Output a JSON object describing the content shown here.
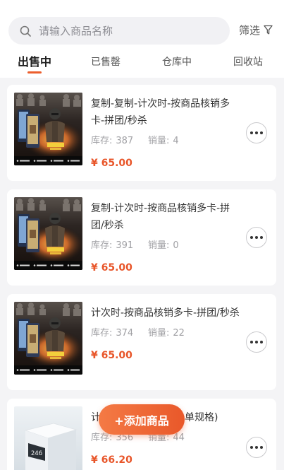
{
  "search": {
    "placeholder": "请输入商品名称"
  },
  "filter": {
    "label": "筛选"
  },
  "tabs": [
    {
      "label": "出售中",
      "active": true
    },
    {
      "label": "已售罄",
      "active": false
    },
    {
      "label": "仓库中",
      "active": false
    },
    {
      "label": "回收站",
      "active": false
    }
  ],
  "products": [
    {
      "title_lines": [
        "复制-复制-计次时-按商品核销多",
        "卡-拼团/秒杀"
      ],
      "stock_label": "库存:",
      "stock": "387",
      "sales_label": "销量:",
      "sales": "4",
      "price": "¥ 65.00",
      "image": "game-poster"
    },
    {
      "title_lines": [
        "复制-计次时-按商品核销多卡-拼",
        "团/秒杀"
      ],
      "stock_label": "库存:",
      "stock": "391",
      "sales_label": "销量:",
      "sales": "0",
      "price": "¥ 65.00",
      "image": "game-poster"
    },
    {
      "title_lines": [
        "计次时-按商品核销多卡-拼团/秒杀"
      ],
      "stock_label": "库存:",
      "stock": "374",
      "sales_label": "销量:",
      "sales": "22",
      "price": "¥ 65.00",
      "image": "game-poster"
    },
    {
      "title_visible_parts": [
        "计",
        "单规格)"
      ],
      "stock_label": "库存:",
      "stock": "356",
      "sales_label": "销量:",
      "sales": "44",
      "price": "¥ 66.20",
      "image": "device-photo",
      "image_screen_text": "246"
    }
  ],
  "fab": {
    "label": "+添加商品"
  },
  "icons": {
    "search": "search-icon",
    "filter": "filter-icon",
    "more": "more-icon"
  },
  "colors": {
    "accent": "#ec5e2d",
    "price": "#e8562a",
    "list_background": "#f4f4f6",
    "search_background": "#f1f1f4"
  }
}
